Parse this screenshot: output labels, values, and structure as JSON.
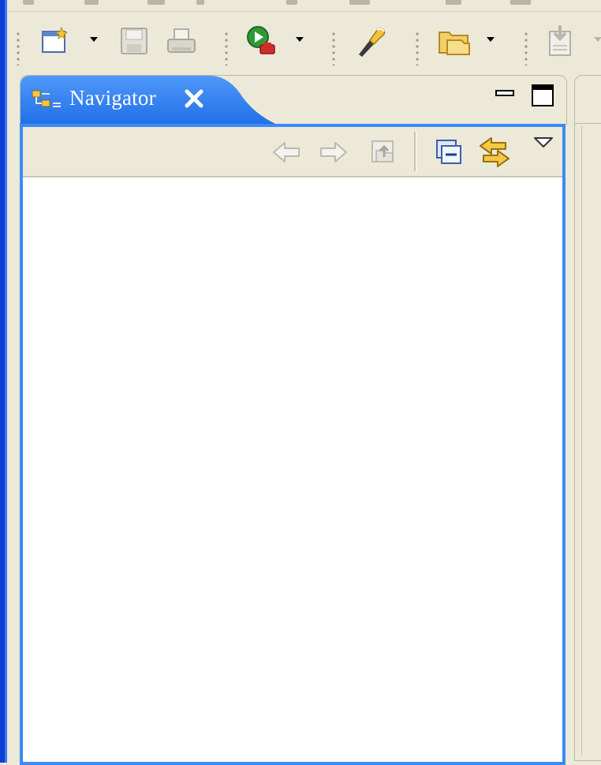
{
  "window": {
    "border_color": "#0b3fd6",
    "background": "#ece9d8"
  },
  "toolbar": {
    "items": [
      {
        "icon": "new-wizard-icon",
        "has_dropdown": true
      },
      {
        "icon": "save-icon",
        "enabled": false
      },
      {
        "icon": "print-icon",
        "enabled": false
      },
      {
        "icon": "run-icon",
        "has_dropdown": true
      },
      {
        "icon": "search-flashlight-icon"
      },
      {
        "icon": "open-folder-icon",
        "has_dropdown": true
      },
      {
        "icon": "import-icon",
        "enabled": false,
        "has_dropdown": true
      }
    ]
  },
  "view": {
    "title": "Navigator",
    "tab_icon": "navigator-icon",
    "close_icon": "close-icon",
    "active_color": "#2f7ef5",
    "frame_color": "#3b8af5",
    "toolbar": [
      {
        "icon": "back-arrow-icon",
        "enabled": false
      },
      {
        "icon": "forward-arrow-icon",
        "enabled": false
      },
      {
        "icon": "up-folder-icon",
        "enabled": false
      },
      {
        "icon": "collapse-all-icon",
        "enabled": true
      },
      {
        "icon": "link-with-editor-icon",
        "enabled": true
      },
      {
        "icon": "view-menu-icon",
        "enabled": true
      }
    ]
  }
}
